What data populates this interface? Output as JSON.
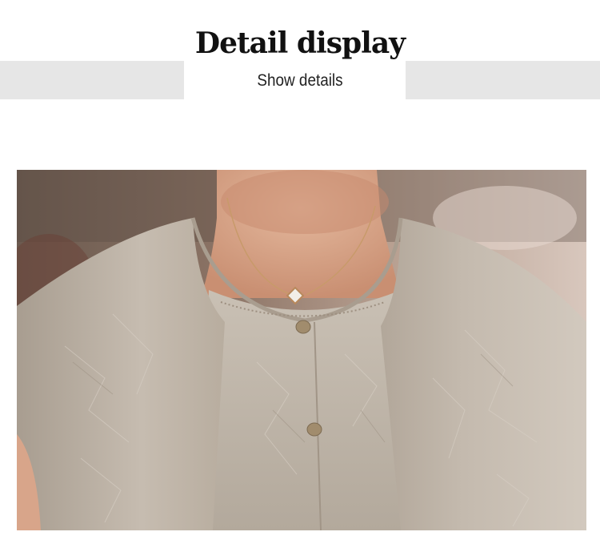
{
  "header": {
    "title": "Detail display",
    "subtitle": "Show details"
  },
  "photo": {
    "alt_subject": "product-detail-photo",
    "colors": {
      "background_top": "#6e5a4e",
      "skin": "#d9a78a",
      "fabric": "#bdb3a7",
      "fabric_shadow": "#a69c90",
      "button": "#9e8a6c",
      "necklace": "#c89a6a"
    }
  }
}
